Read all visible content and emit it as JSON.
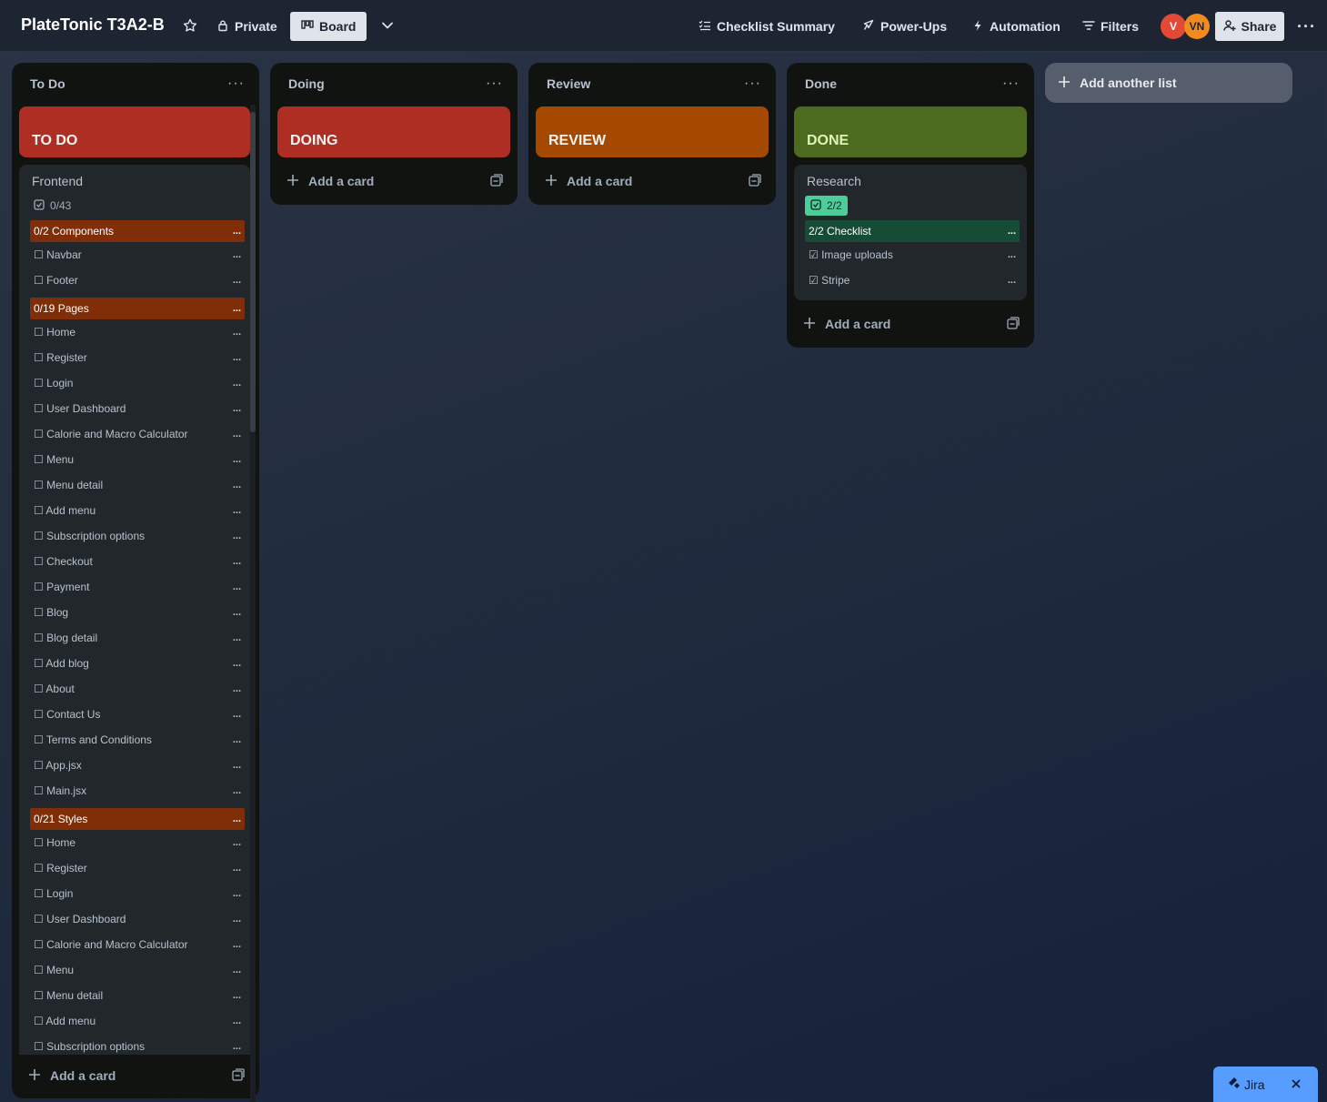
{
  "header": {
    "board_title": "PlateTonic T3A2-B",
    "visibility_label": "Private",
    "view_label": "Board",
    "checklist_summary_label": "Checklist Summary",
    "powerups_label": "Power-Ups",
    "automation_label": "Automation",
    "filters_label": "Filters",
    "avatars": [
      {
        "initials": "V",
        "color": "#e34935"
      },
      {
        "initials": "VN",
        "color": "#f38a1f"
      }
    ],
    "share_label": "Share"
  },
  "lists": {
    "todo": {
      "title": "To Do",
      "cover": {
        "label": "TO DO",
        "color": "#ae2e24"
      },
      "card": {
        "title": "Frontend",
        "badge": "0/43",
        "items": [
          {
            "type": "header",
            "text": "0/2 Components"
          },
          {
            "type": "item",
            "text": "☐ Navbar"
          },
          {
            "type": "item",
            "text": "☐ Footer"
          },
          {
            "type": "header",
            "text": "0/19 Pages"
          },
          {
            "type": "item",
            "text": "☐ Home"
          },
          {
            "type": "item",
            "text": "☐ Register"
          },
          {
            "type": "item",
            "text": "☐ Login"
          },
          {
            "type": "item",
            "text": "☐ User Dashboard"
          },
          {
            "type": "item",
            "text": "☐ Calorie and Macro Calculator"
          },
          {
            "type": "item",
            "text": "☐ Menu"
          },
          {
            "type": "item",
            "text": "☐ Menu detail"
          },
          {
            "type": "item",
            "text": "☐ Add menu"
          },
          {
            "type": "item",
            "text": "☐ Subscription options"
          },
          {
            "type": "item",
            "text": "☐ Checkout"
          },
          {
            "type": "item",
            "text": "☐ Payment"
          },
          {
            "type": "item",
            "text": "☐ Blog"
          },
          {
            "type": "item",
            "text": "☐ Blog detail"
          },
          {
            "type": "item",
            "text": "☐ Add blog"
          },
          {
            "type": "item",
            "text": "☐ About"
          },
          {
            "type": "item",
            "text": "☐ Contact Us"
          },
          {
            "type": "item",
            "text": "☐ Terms and Conditions"
          },
          {
            "type": "item",
            "text": "☐ App.jsx"
          },
          {
            "type": "item",
            "text": "☐ Main.jsx"
          },
          {
            "type": "header",
            "text": "0/21 Styles"
          },
          {
            "type": "item",
            "text": "☐ Home"
          },
          {
            "type": "item",
            "text": "☐ Register"
          },
          {
            "type": "item",
            "text": "☐ Login"
          },
          {
            "type": "item",
            "text": "☐ User Dashboard"
          },
          {
            "type": "item",
            "text": "☐ Calorie and Macro Calculator"
          },
          {
            "type": "item",
            "text": "☐ Menu"
          },
          {
            "type": "item",
            "text": "☐ Menu detail"
          },
          {
            "type": "item",
            "text": "☐ Add menu"
          },
          {
            "type": "item",
            "text": "☐ Subscription options"
          }
        ]
      },
      "add_card_label": "Add a card"
    },
    "doing": {
      "title": "Doing",
      "cover": {
        "label": "DOING",
        "color": "#ae2e24"
      },
      "add_card_label": "Add a card"
    },
    "review": {
      "title": "Review",
      "cover": {
        "label": "REVIEW",
        "color": "#a54800"
      },
      "add_card_label": "Add a card"
    },
    "done": {
      "title": "Done",
      "cover": {
        "label": "DONE",
        "color": "#4c6b1f"
      },
      "card": {
        "title": "Research",
        "badge": "2/2",
        "items": [
          {
            "type": "header",
            "text": "2/2 Checklist"
          },
          {
            "type": "item",
            "text": "☑ Image uploads"
          },
          {
            "type": "item",
            "text": "☑ Stripe"
          }
        ]
      },
      "add_card_label": "Add a card"
    }
  },
  "add_list_label": "Add another list",
  "jira": {
    "label": "Jira"
  },
  "colors": {
    "incomplete_header": "#7f2e08",
    "complete_header": "#164b35",
    "complete_badge": "#4bce97"
  }
}
